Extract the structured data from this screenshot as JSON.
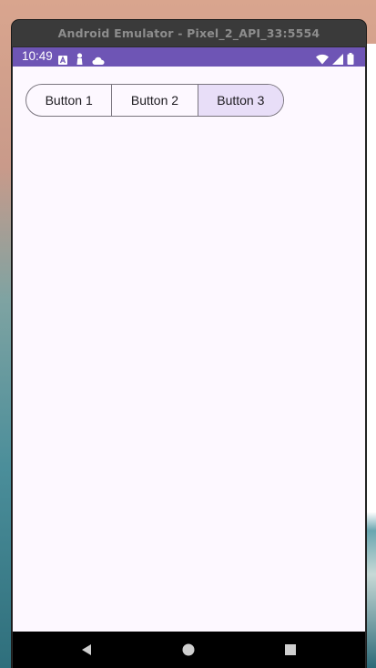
{
  "window": {
    "title": "Android Emulator - Pixel_2_API_33:5554"
  },
  "status_bar": {
    "time": "10:49",
    "left_icons": [
      "a-badge-icon",
      "person-pin-icon",
      "cloud-icon"
    ],
    "right_icons": [
      "wifi-icon",
      "cellular-signal-icon",
      "battery-icon"
    ],
    "color": "#6e55b5"
  },
  "segmented_buttons": {
    "items": [
      {
        "label": "Button 1",
        "selected": false
      },
      {
        "label": "Button 2",
        "selected": false
      },
      {
        "label": "Button 3",
        "selected": true
      }
    ],
    "selected_color": "#e8def8",
    "outline_color": "#7a757f"
  },
  "nav_bar": {
    "buttons": [
      "back-triangle-icon",
      "home-circle-icon",
      "recents-square-icon"
    ]
  },
  "colors": {
    "app_background": "#fdf8ff",
    "text": "#1d1b20"
  }
}
